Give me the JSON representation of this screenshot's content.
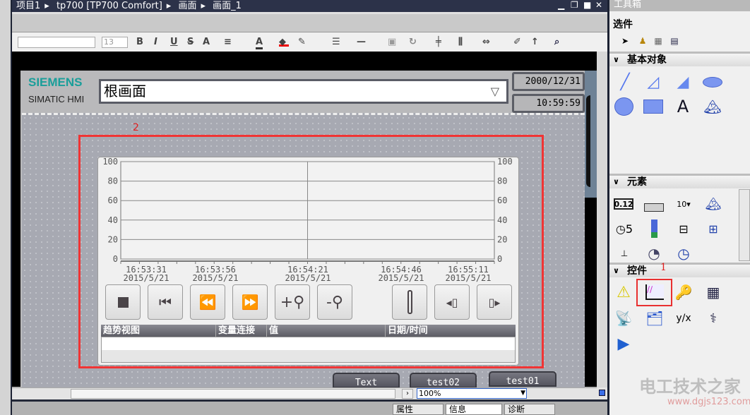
{
  "breadcrumb": [
    "项目1",
    "tp700 [TP700 Comfort]",
    "画面",
    "画面_1"
  ],
  "window_controls": [
    "minimize",
    "restore",
    "maximize",
    "close"
  ],
  "toolbar": {
    "font_size": "13",
    "buttons": [
      "B",
      "I",
      "U",
      "S",
      "A",
      "≡",
      "A",
      "fill-color",
      "pen-color",
      "line-width",
      "line-style",
      "arrange",
      "rotate",
      "align",
      "distribute",
      "size",
      "format-painter",
      "text-size",
      "zoom-select"
    ]
  },
  "hmi": {
    "brand": "SIEMENS",
    "model": "SIMATIC HMI",
    "screen_select": "根画面",
    "date": "2000/12/31",
    "time": "10:59:59",
    "marker_2": "2",
    "buttons": [
      "Text",
      "test02",
      "test01"
    ]
  },
  "chart_data": {
    "type": "line",
    "y_ticks": [
      0,
      20,
      40,
      60,
      80,
      100
    ],
    "ylim": [
      0,
      100
    ],
    "x_ticks": [
      {
        "time": "16:53:31",
        "date": "2015/5/21"
      },
      {
        "time": "16:53:56",
        "date": "2015/5/21"
      },
      {
        "time": "16:54:21",
        "date": "2015/5/21"
      },
      {
        "time": "16:54:46",
        "date": "2015/5/21"
      },
      {
        "time": "16:55:11",
        "date": "2015/5/21"
      }
    ],
    "series": [],
    "grid": true
  },
  "trend_buttons": [
    "stop",
    "first",
    "back",
    "forward",
    "zoom-in",
    "zoom-out",
    "ruler",
    "ruler-left",
    "ruler-right"
  ],
  "table": {
    "headers": [
      "趋势视图",
      "变量连接",
      "值",
      "日期/时间"
    ]
  },
  "zoom": "100%",
  "status_tabs": [
    "属性",
    "信息",
    "诊断"
  ],
  "toolbox": {
    "title": "工具箱",
    "sections": {
      "selection": "选件",
      "basic": "基本对象",
      "elements": "元素",
      "controls": "控件"
    },
    "marker_1": "1"
  },
  "watermark": {
    "text": "电工技术之家",
    "url": "www.dgjs123.com"
  },
  "colors": {
    "accent_red": "#f03434",
    "siemens_teal": "#1a9e9a",
    "title_bar": "#2c3249"
  }
}
